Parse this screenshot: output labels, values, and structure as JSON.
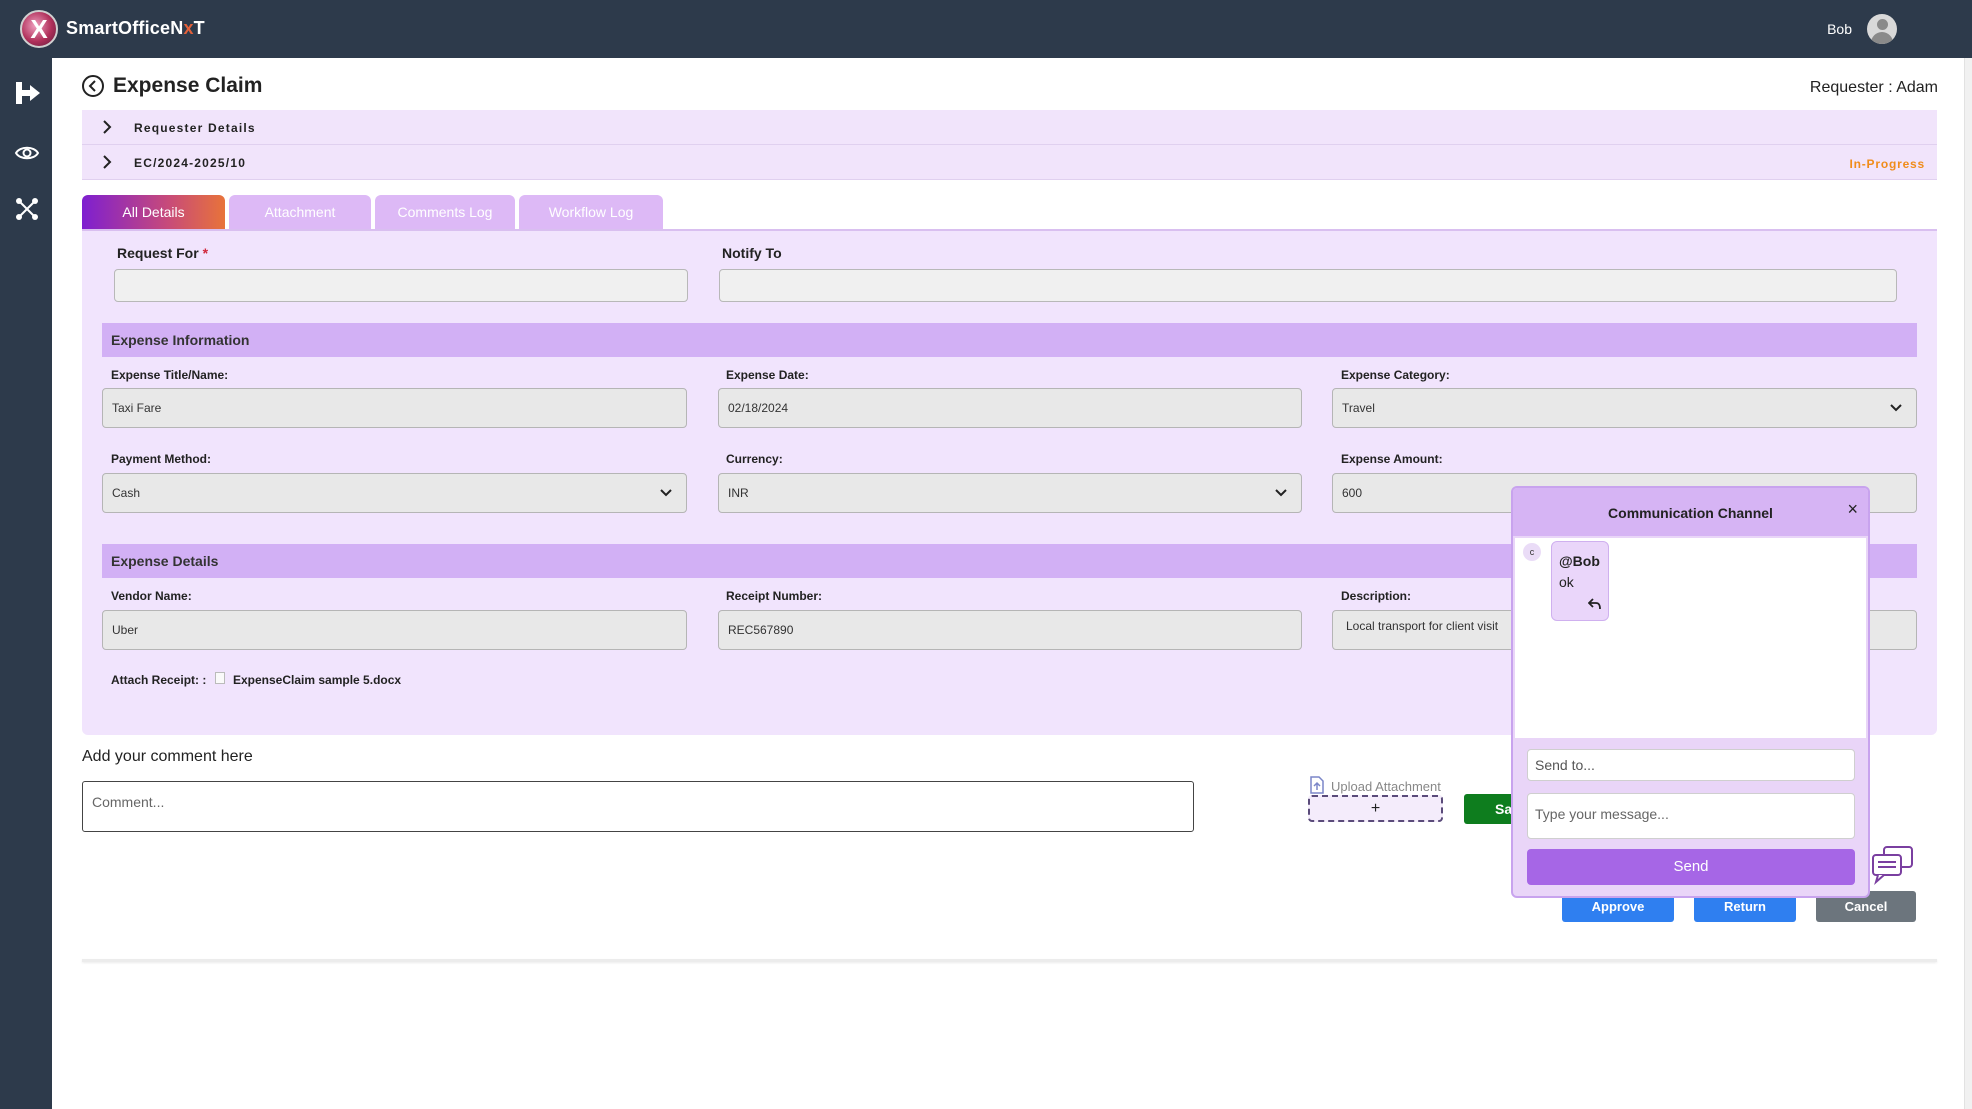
{
  "brand": {
    "name_prefix": "SmartOfficeN",
    "name_accent": "x",
    "name_suffix": "T",
    "logo_letter": "X"
  },
  "topbar": {
    "user_name": "Bob"
  },
  "sidebar": {
    "icons": [
      "exit-icon",
      "eye-icon",
      "workflow-icon"
    ]
  },
  "header": {
    "title": "Expense Claim",
    "requester": "Requester : Adam"
  },
  "accordion": [
    {
      "label": "Requester Details"
    },
    {
      "label": "EC/2024-2025/10",
      "status": "In-Progress"
    }
  ],
  "colors": {
    "status": "#f08c1a",
    "accent": "#a666e6",
    "save": "#0e7d1e",
    "approve": "#2f7ff0",
    "cancel": "#6c757d"
  },
  "tabs": [
    {
      "label": "All Details",
      "active": true
    },
    {
      "label": "Attachment"
    },
    {
      "label": "Comments Log"
    },
    {
      "label": "Workflow Log"
    }
  ],
  "form": {
    "request_for_label": "Request For",
    "required_mark": "*",
    "request_for_value": "",
    "notify_to_label": "Notify To",
    "notify_to_value": ""
  },
  "expense_info": {
    "section_title": "Expense Information",
    "title_label": "Expense Title/Name:",
    "title_value": "Taxi Fare",
    "date_label": "Expense Date:",
    "date_value": "02/18/2024",
    "category_label": "Expense Category:",
    "category_value": "Travel",
    "payment_label": "Payment Method:",
    "payment_value": "Cash",
    "currency_label": "Currency:",
    "currency_value": "INR",
    "amount_label": "Expense Amount:",
    "amount_value": "600"
  },
  "expense_details": {
    "section_title": "Expense Details",
    "vendor_label": "Vendor Name:",
    "vendor_value": "Uber",
    "receipt_label": "Receipt Number:",
    "receipt_value": "REC567890",
    "description_label": "Description:",
    "description_value": "Local transport for client visit",
    "attach_label": "Attach Receipt: :",
    "attach_file": "ExpenseClaim sample 5.docx"
  },
  "comment": {
    "title": "Add your comment here",
    "placeholder": "Comment...",
    "upload_label": "Upload Attachment",
    "upload_plus": "+"
  },
  "actions": {
    "save_label": "Sa",
    "approve_label": "Approve",
    "return_label": "Return",
    "cancel_label": "Cancel"
  },
  "chat": {
    "title": "Communication Channel",
    "close": "×",
    "avatar": "c",
    "messages": [
      {
        "mention": "@Bob",
        "text": "ok"
      }
    ],
    "send_to_placeholder": "Send to...",
    "message_placeholder": "Type your message...",
    "send_label": "Send"
  }
}
